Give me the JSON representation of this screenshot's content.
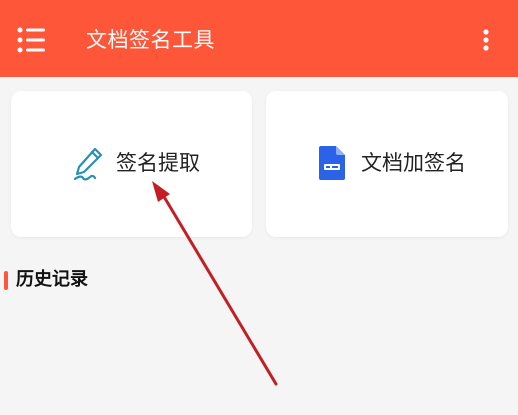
{
  "app_bar": {
    "title": "文档签名工具",
    "menu_icon": "list-menu-icon",
    "more_icon": "vertical-dots-icon",
    "color": "#fe5639"
  },
  "cards": [
    {
      "label": "签名提取",
      "icon": "pen-signature-icon",
      "icon_color": "#2a8fb5"
    },
    {
      "label": "文档加签名",
      "icon": "document-file-icon",
      "icon_color": "#2a62e8"
    }
  ],
  "history": {
    "title": "历史记录",
    "accent": "#fe5639"
  },
  "annotation": {
    "color": "#c41e25",
    "icon": "arrow-pointer-icon"
  }
}
